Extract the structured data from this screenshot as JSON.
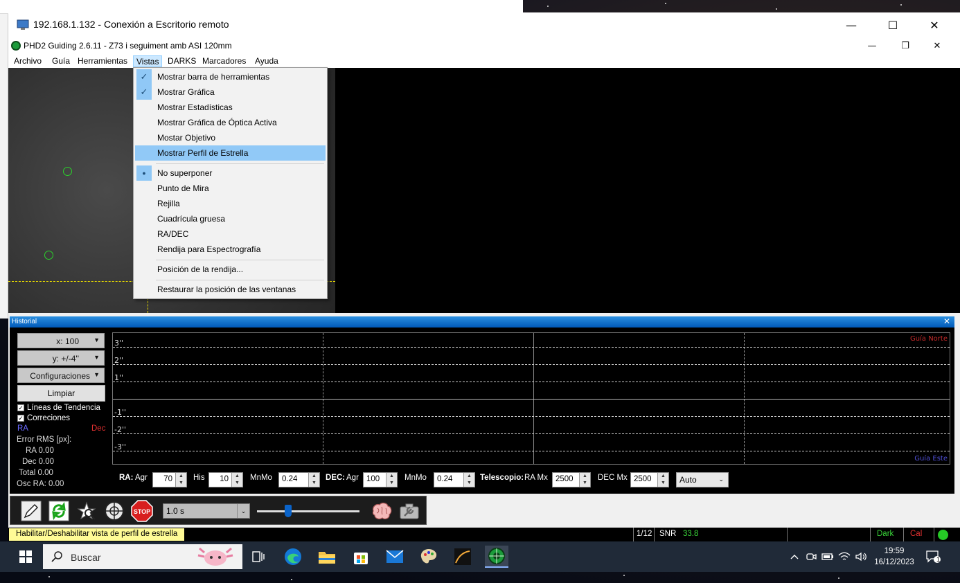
{
  "remote_window": {
    "title": "192.168.1.132 - Conexión a Escritorio remoto",
    "minimize": "—",
    "maximize": "☐",
    "close": "✕"
  },
  "app": {
    "title": "PHD2 Guiding 2.6.11 - Z73 i seguiment amb ASI 120mm",
    "minimize": "—",
    "restore": "❐",
    "close": "✕",
    "menu": [
      "Archivo",
      "Guía",
      "Herramientas",
      "Vistas",
      "DARKS",
      "Marcadores",
      "Ayuda"
    ]
  },
  "vistas_menu": {
    "items": [
      {
        "label": "Mostrar barra de herramientas",
        "mark": "✓"
      },
      {
        "label": "Mostrar Gráfica",
        "mark": "✓"
      },
      {
        "label": "Mostrar Estadísticas",
        "mark": ""
      },
      {
        "label": "Mostrar Gráfica de Óptica Activa",
        "mark": ""
      },
      {
        "label": "Mostar Objetivo",
        "mark": ""
      },
      {
        "label": "Mostrar Perfil de Estrella",
        "mark": ""
      },
      {
        "label": "No superponer",
        "mark": "●"
      },
      {
        "label": "Punto de Mira",
        "mark": ""
      },
      {
        "label": "Rejilla",
        "mark": ""
      },
      {
        "label": "Cuadrícula gruesa",
        "mark": ""
      },
      {
        "label": "RA/DEC",
        "mark": ""
      },
      {
        "label": "Rendija para Espectrografía",
        "mark": ""
      },
      {
        "label": "Posición de la rendija...",
        "mark": ""
      },
      {
        "label": "Restaurar la posición de las ventanas",
        "mark": ""
      }
    ]
  },
  "history": {
    "title": "Historial",
    "close": "✕",
    "x_combo": "x: 100",
    "y_combo": "y: +/-4''",
    "config_combo": "Configuraciones",
    "clear_button": "Limpiar",
    "trend_lines": "Líneas de Tendencia",
    "corrections": "Correciones",
    "ra_label": "RA",
    "dec_label": "Dec",
    "rms_title": "Error RMS [px]:",
    "rms_ra": "RA 0.00",
    "rms_dec": "Dec 0.00",
    "rms_total": "Total 0.00",
    "osc_ra": "Osc RA: 0.00",
    "y_labels": [
      "3''",
      "2''",
      "1''",
      "-1''",
      "-2''",
      "-3''"
    ],
    "guide_north": "Guía Norte",
    "guide_east": "Guía Este",
    "ra_prefix": "RA:",
    "agr": "Agr",
    "ra_agr": "70",
    "his": "His",
    "ra_his": "10",
    "mnmo": "MnMo",
    "ra_mnmo": "0.24",
    "dec_prefix": "DEC:",
    "dec_agr": "100",
    "dec_mnmo": "0.24",
    "telescope": "Telescopio:",
    "ra_mx_label": "RA Mx",
    "ra_mx": "2500",
    "dec_mx_label": "DEC Mx",
    "dec_mx": "2500",
    "mode": "Auto"
  },
  "toolbar": {
    "exposure": "1.0 s"
  },
  "status": {
    "tip": "Habilitar/Deshabilitar vista de perfil de estrella",
    "frame": "1/12",
    "snr_label": "SNR",
    "snr": "33.8",
    "dark": "Dark",
    "cal": "Cal"
  },
  "taskbar": {
    "search": "Buscar",
    "time": "19:59",
    "date": "16/12/2023",
    "notifications": "1"
  },
  "colors": {
    "accent": "#0059b8",
    "snr_green": "#3ad63a",
    "dark_green": "#3ad63a",
    "cal_red": "#e03030",
    "ra_blue": "#6a6aff",
    "dec_red": "#e03030"
  }
}
